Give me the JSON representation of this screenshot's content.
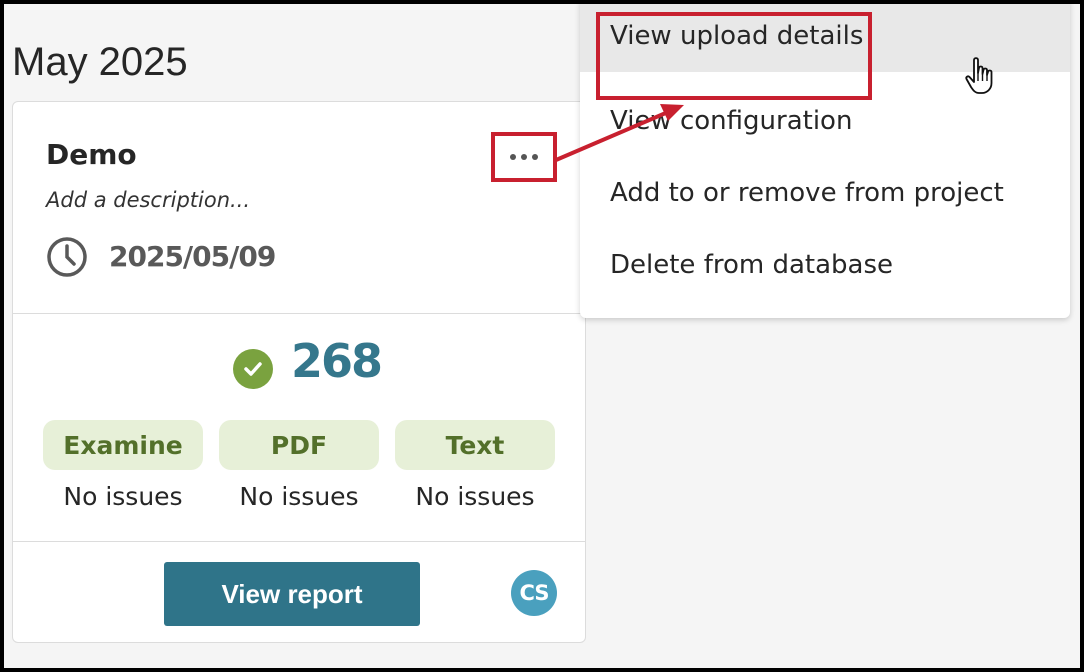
{
  "section": {
    "month": "May 2025"
  },
  "card": {
    "title": "Demo",
    "description": "Add a description...",
    "date": "2025/05/09",
    "count": "268",
    "checks": [
      {
        "label": "Examine",
        "status": "No issues"
      },
      {
        "label": "PDF",
        "status": "No issues"
      },
      {
        "label": "Text",
        "status": "No issues"
      }
    ],
    "view_report_label": "View report",
    "avatar_initials": "CS"
  },
  "menu": {
    "items": [
      {
        "label": "View upload details"
      },
      {
        "label": "View configuration"
      },
      {
        "label": "Add to or remove from project"
      },
      {
        "label": "Delete from database"
      }
    ]
  },
  "colors": {
    "accent": "#2f7489",
    "count": "#35778c",
    "success": "#7aa23f",
    "pill_bg": "#e7f0d8",
    "pill_text": "#53702a",
    "annotation": "#c8202f",
    "avatar": "#4aa0be"
  },
  "icons": [
    "clock-icon",
    "more-options-icon",
    "check-circle-icon",
    "hand-cursor-icon"
  ]
}
